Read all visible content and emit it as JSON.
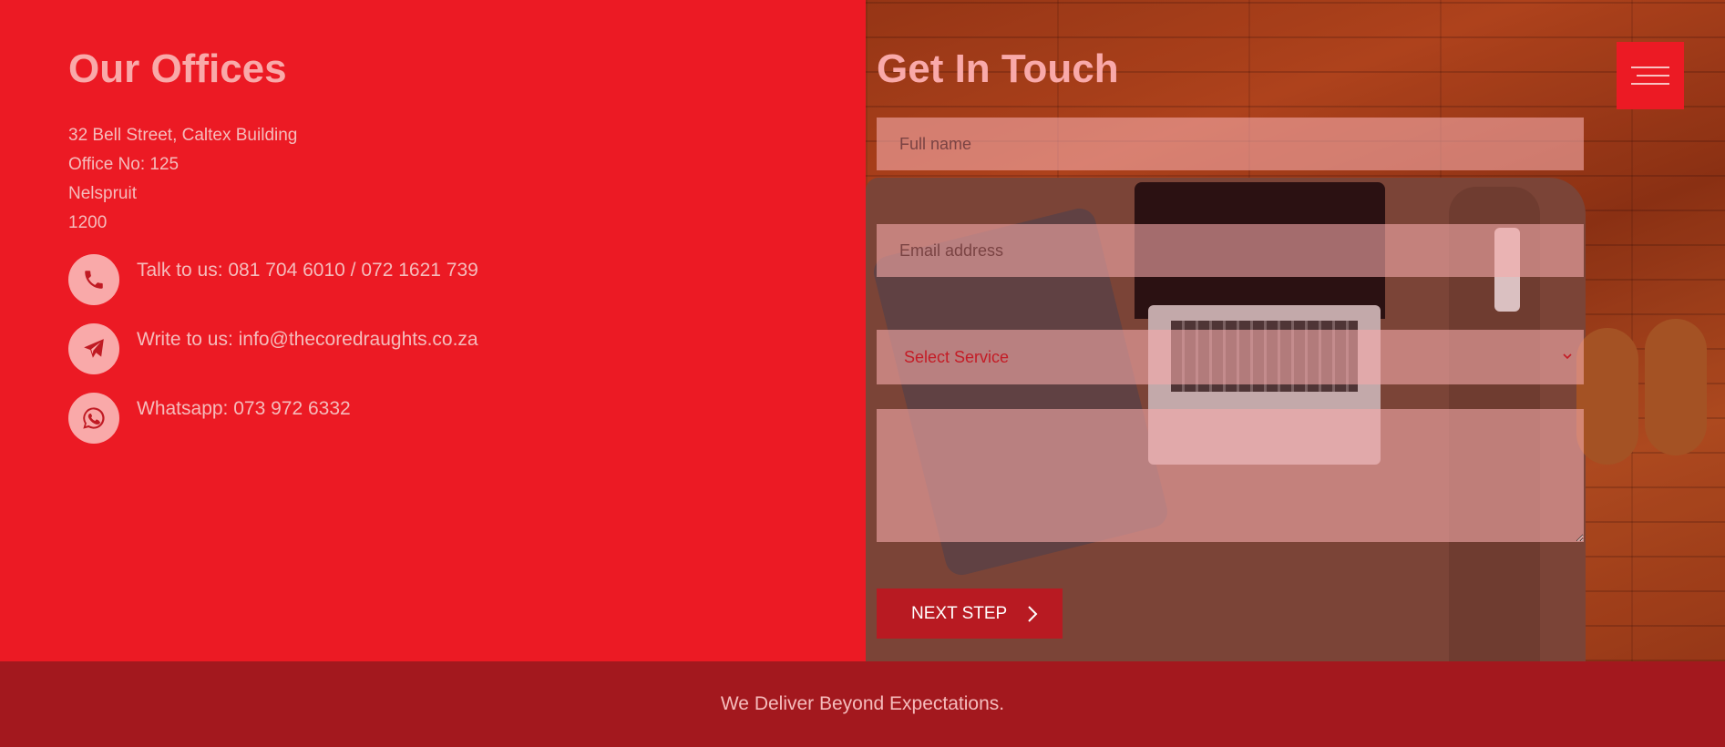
{
  "offices": {
    "title": "Our Offices",
    "address_lines": [
      "32 Bell Street, Caltex Building",
      "Office No: 125",
      "Nelspruit",
      "1200"
    ],
    "contacts": [
      {
        "icon": "phone-icon",
        "text": "Talk to us: 081 704 6010 / 072 1621 739"
      },
      {
        "icon": "paper-plane-icon",
        "text": "Write to us: info@thecoredraughts.co.za"
      },
      {
        "icon": "whatsapp-icon",
        "text": "Whatsapp: 073 972 6332"
      }
    ]
  },
  "contact_form": {
    "title": "Get In Touch",
    "full_name_placeholder": "Full name",
    "email_placeholder": "Email address",
    "service_selected": "Select Service",
    "next_button_label": "NEXT STEP"
  },
  "menu": {
    "icon": "hamburger-menu-icon"
  },
  "footer": {
    "tagline": "We Deliver Beyond Expectations."
  },
  "colors": {
    "brand_red": "#ec1a24",
    "dark_red": "#a3181e",
    "button_red": "#b81a22",
    "title_pink": "#f9a9a9"
  }
}
